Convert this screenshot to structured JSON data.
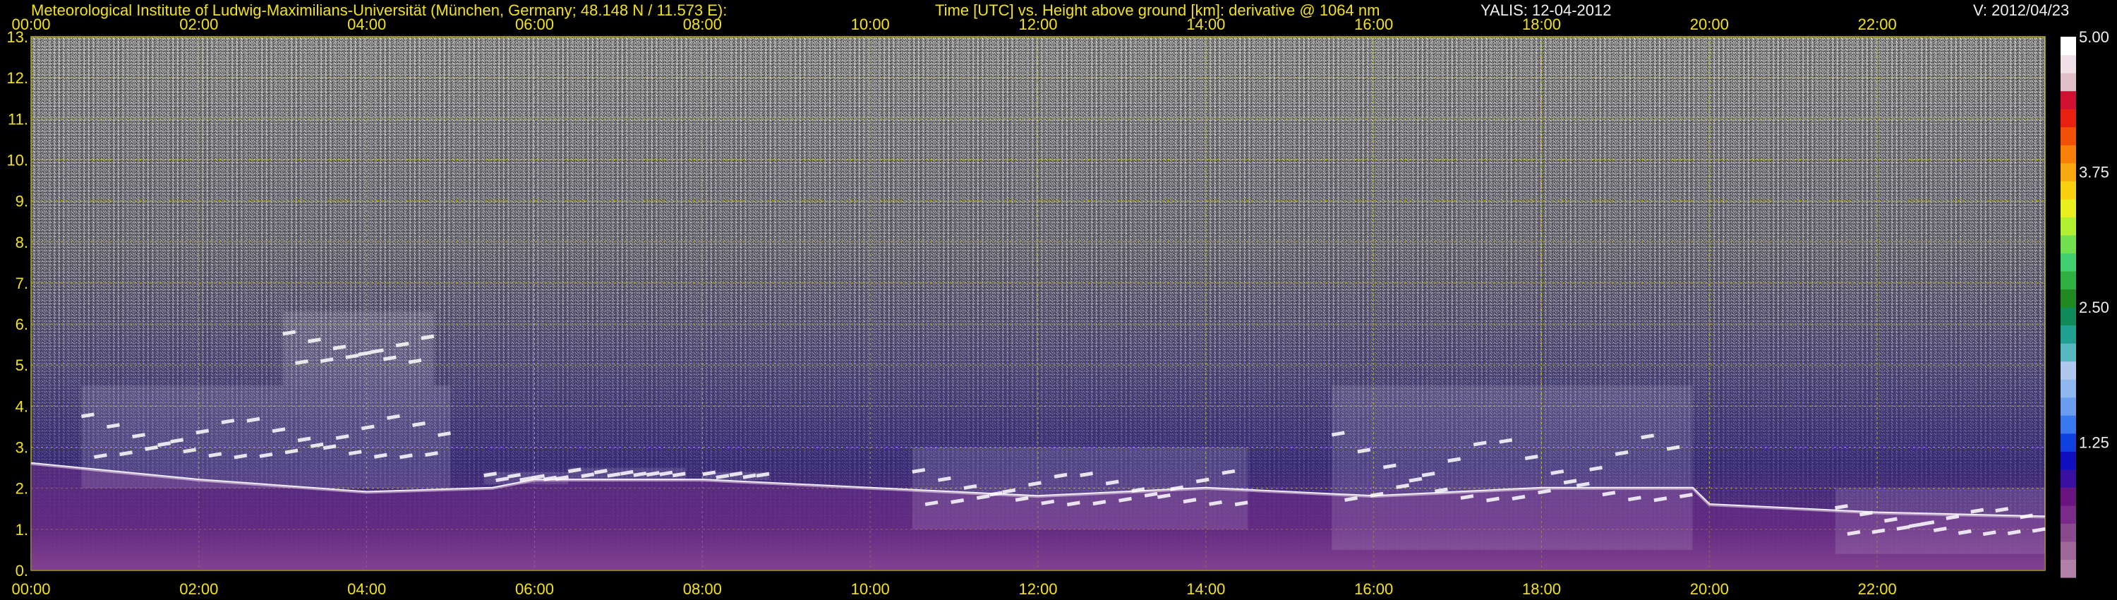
{
  "header": {
    "institute": "Meteorological Institute of Ludwig-Maximilians-Universität (München, Germany; 48.148 N / 11.573 E):",
    "title": "Time [UTC] vs. Height above ground [km]: derivative @ 1064 nm",
    "station": "YALIS: 12-04-2012",
    "version": "V: 2012/04/23"
  },
  "colors": {
    "text_yellow": "#f2e21a",
    "text_white": "#f0f0f0",
    "grid": "#b8b020",
    "background": "#000000"
  },
  "chart_data": {
    "type": "heatmap",
    "title": "Time [UTC] vs. Height above ground [km]: derivative @ 1064 nm",
    "x_tick_labels": [
      "00:00",
      "02:00",
      "04:00",
      "06:00",
      "08:00",
      "10:00",
      "12:00",
      "14:00",
      "16:00",
      "18:00",
      "20:00",
      "22:00"
    ],
    "x_ticks_hours": [
      0,
      2,
      4,
      6,
      8,
      10,
      12,
      14,
      16,
      18,
      20,
      22
    ],
    "xlim_hours": [
      0,
      24
    ],
    "y_tick_labels": [
      "0.",
      "1.",
      "2.",
      "3.",
      "4.",
      "5.",
      "6.",
      "7.",
      "8.",
      "9.",
      "10.",
      "11.",
      "12.",
      "13."
    ],
    "y_ticks_km": [
      0,
      1,
      2,
      3,
      4,
      5,
      6,
      7,
      8,
      9,
      10,
      11,
      12,
      13
    ],
    "ylim_km": [
      0,
      13
    ],
    "grid": true,
    "colorbar": {
      "tick_labels": [
        "5.00",
        "3.75",
        "2.50",
        "1.25"
      ],
      "ticks": [
        5.0,
        3.75,
        2.5,
        1.25
      ],
      "range": [
        0,
        5.0
      ],
      "colors": [
        "#b080a8",
        "#a06898",
        "#8a4a90",
        "#7a2a88",
        "#6a1480",
        "#3a10a0",
        "#1010c0",
        "#1040e0",
        "#3a78f0",
        "#6a9cf0",
        "#90b8f0",
        "#b0c8f0",
        "#58b8c0",
        "#20a090",
        "#108a58",
        "#208a20",
        "#30b040",
        "#40d070",
        "#70e050",
        "#b0f030",
        "#e8f020",
        "#f8d010",
        "#f8a810",
        "#f88008",
        "#f05008",
        "#e82010",
        "#d01030",
        "#e0c0c8",
        "#f0e0e8",
        "#ffffff"
      ]
    },
    "features": [
      {
        "name": "aerosol layer top",
        "x_hours": [
          0,
          2,
          4,
          5.5,
          6,
          8,
          10,
          12,
          14,
          16,
          18,
          19.8,
          20,
          22,
          24
        ],
        "y_km": [
          2.6,
          2.2,
          1.9,
          2.0,
          2.2,
          2.2,
          2.0,
          1.8,
          2.0,
          1.8,
          2.0,
          2.0,
          1.6,
          1.4,
          1.3
        ]
      },
      {
        "name": "cloud segments",
        "segments": [
          {
            "x_hours": [
              0.6,
              5.0
            ],
            "y_km": [
              2.0,
              4.5
            ]
          },
          {
            "x_hours": [
              3.0,
              4.8
            ],
            "y_km": [
              4.5,
              6.3
            ]
          },
          {
            "x_hours": [
              5.4,
              6.4
            ],
            "y_km": [
              2.1,
              2.4
            ]
          },
          {
            "x_hours": [
              6.4,
              7.8
            ],
            "y_km": [
              2.2,
              2.5
            ]
          },
          {
            "x_hours": [
              8.0,
              8.8
            ],
            "y_km": [
              2.2,
              2.4
            ]
          },
          {
            "x_hours": [
              10.5,
              14.5
            ],
            "y_km": [
              1.0,
              3.0
            ]
          },
          {
            "x_hours": [
              15.5,
              19.8
            ],
            "y_km": [
              0.5,
              4.5
            ]
          },
          {
            "x_hours": [
              21.5,
              24.0
            ],
            "y_km": [
              0.4,
              2.0
            ]
          }
        ]
      }
    ]
  }
}
